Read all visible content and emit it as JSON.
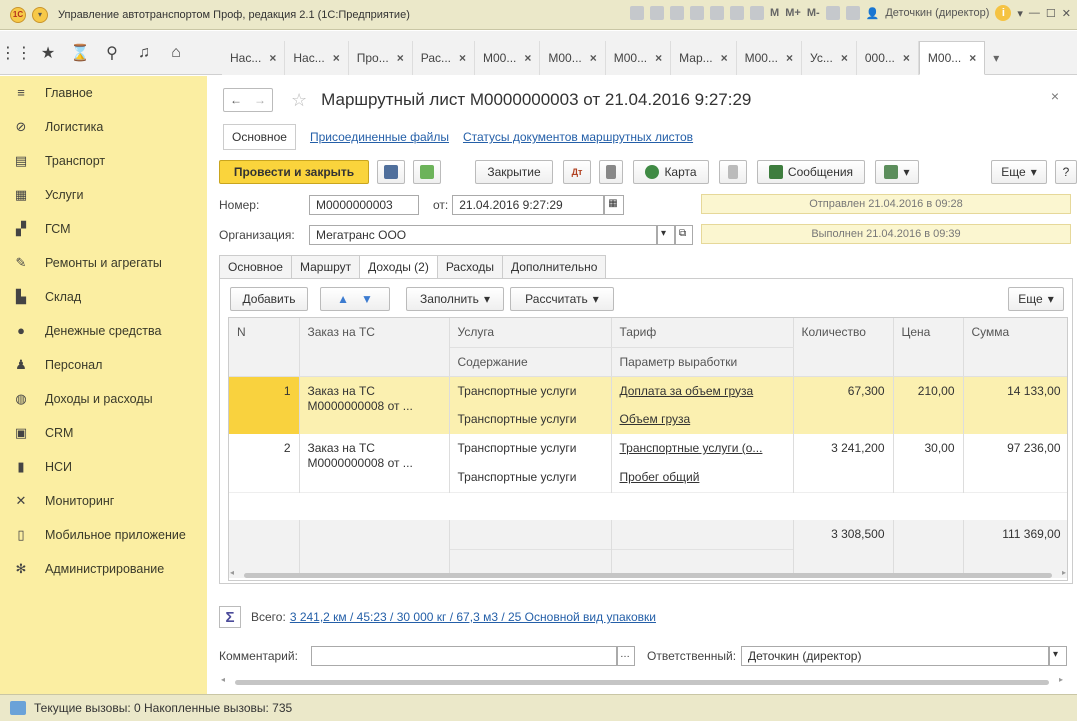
{
  "window": {
    "title": "Управление автотранспортом Проф, редакция 2.1  (1С:Предприятие)",
    "logo": "1С",
    "tools_labels": [
      "M",
      "M+",
      "M-"
    ],
    "user": "Деточкин (директор)"
  },
  "tabs": [
    {
      "label": "Нас..."
    },
    {
      "label": "Нас..."
    },
    {
      "label": "Про..."
    },
    {
      "label": "Рас..."
    },
    {
      "label": "М00..."
    },
    {
      "label": "М00..."
    },
    {
      "label": "М00..."
    },
    {
      "label": "Мар..."
    },
    {
      "label": "М00..."
    },
    {
      "label": "Ус..."
    },
    {
      "label": "000..."
    },
    {
      "label": "М00..."
    }
  ],
  "sidebar": {
    "items": [
      {
        "label": "Главное",
        "icon": "menu-icon"
      },
      {
        "label": "Логистика",
        "icon": "logistics-icon"
      },
      {
        "label": "Транспорт",
        "icon": "bus-icon"
      },
      {
        "label": "Услуги",
        "icon": "calculator-icon"
      },
      {
        "label": "ГСМ",
        "icon": "fuel-icon"
      },
      {
        "label": "Ремонты и агрегаты",
        "icon": "wrench-icon"
      },
      {
        "label": "Склад",
        "icon": "warehouse-icon"
      },
      {
        "label": "Денежные средства",
        "icon": "money-icon"
      },
      {
        "label": "Персонал",
        "icon": "people-icon"
      },
      {
        "label": "Доходы и расходы",
        "icon": "coins-icon"
      },
      {
        "label": "CRM",
        "icon": "crm-icon"
      },
      {
        "label": "НСИ",
        "icon": "book-icon"
      },
      {
        "label": "Мониторинг",
        "icon": "satellite-icon"
      },
      {
        "label": "Мобильное приложение",
        "icon": "mobile-icon"
      },
      {
        "label": "Администрирование",
        "icon": "gear-icon"
      }
    ]
  },
  "document": {
    "title": "Маршрутный лист М0000000003 от 21.04.2016 9:27:29",
    "subtabs": {
      "main": "Основное",
      "files": "Присоединенные файлы",
      "statuses": "Статусы документов маршрутных листов"
    }
  },
  "toolbar": {
    "post_close": "Провести и закрыть",
    "closing": "Закрытие",
    "map": "Карта",
    "messages": "Сообщения",
    "more": "Еще"
  },
  "form": {
    "number_label": "Номер:",
    "number_value": "М0000000003",
    "date_label": "от:",
    "date_value": "21.04.2016  9:27:29",
    "org_label": "Организация:",
    "org_value": "Мегатранс ООО",
    "status_sent": "Отправлен 21.04.2016 в 09:28",
    "status_done": "Выполнен 21.04.2016 в 09:39"
  },
  "inner_tabs": [
    "Основное",
    "Маршрут",
    "Доходы (2)",
    "Расходы",
    "Дополнительно"
  ],
  "income": {
    "add": "Добавить",
    "fill": "Заполнить",
    "calc": "Рассчитать",
    "more": "Еще",
    "columns": {
      "n": "N",
      "order": "Заказ на ТС",
      "service": "Услуга",
      "content": "Содержание",
      "tariff": "Тариф",
      "param": "Параметр выработки",
      "qty": "Количество",
      "price": "Цена",
      "sum": "Сумма"
    },
    "rows": [
      {
        "n": "1",
        "order1": "Заказ на ТС",
        "order2": "М0000000008 от ...",
        "service": "Транспортные услуги",
        "content": "Транспортные услуги",
        "tariff": "Доплата за объем груза",
        "param": "Объем груза",
        "qty": "67,300",
        "price": "210,00",
        "sum": "14 133,00"
      },
      {
        "n": "2",
        "order1": "Заказ на ТС",
        "order2": "М0000000008 от ...",
        "service": "Транспортные услуги",
        "content": "Транспортные услуги",
        "tariff": "Транспортные услуги (о...",
        "param": "Пробег общий",
        "qty": "3 241,200",
        "price": "30,00",
        "sum": "97 236,00"
      }
    ],
    "totals": {
      "qty": "3 308,500",
      "sum": "111 369,00"
    }
  },
  "summary": {
    "label": "Всего:",
    "value": "3 241,2 км / 45:23 / 30 000 кг / 67,3 м3 / 25 Основной вид упаковки"
  },
  "comment": {
    "label": "Комментарий:",
    "value": "",
    "responsible_label": "Ответственный:",
    "responsible_value": "Деточкин (директор)"
  },
  "status_bar": {
    "text": "Текущие вызовы: 0   Накопленные вызовы: 735"
  }
}
